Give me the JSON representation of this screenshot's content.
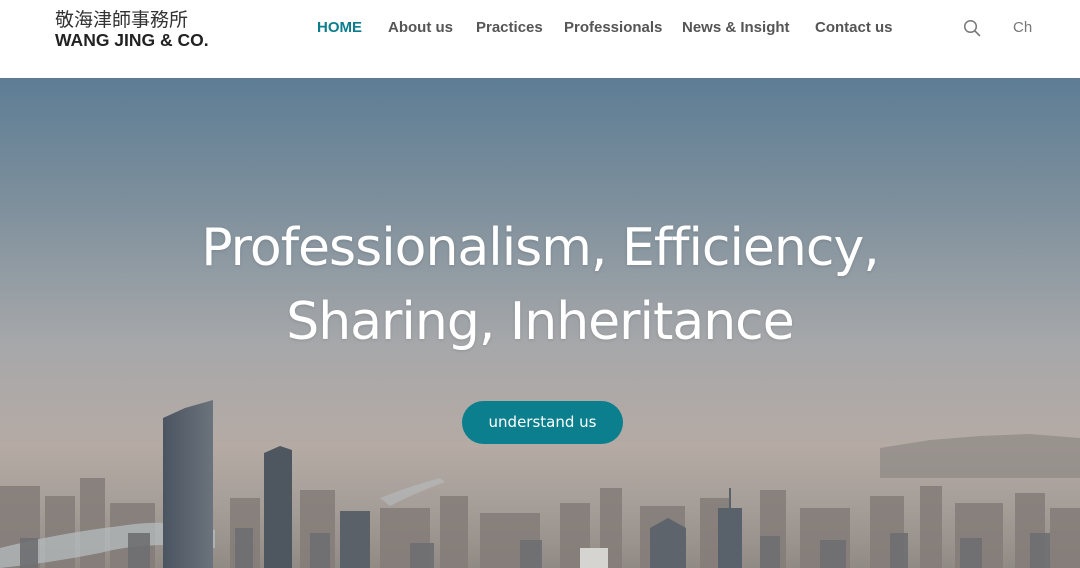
{
  "logo": {
    "chinese": "敬海津師事務所",
    "english": "WANG JING & CO."
  },
  "nav": {
    "items": [
      {
        "label": "HOME",
        "active": true
      },
      {
        "label": "About us"
      },
      {
        "label": "Practices"
      },
      {
        "label": "Professionals"
      },
      {
        "label": "News & Insight"
      },
      {
        "label": "Contact us"
      }
    ],
    "search_icon": "search-icon",
    "language": "Ch"
  },
  "hero": {
    "headline_line1": "Professionalism, Efficiency,",
    "headline_line2": "Sharing, Inheritance",
    "cta_label": "understand us",
    "background_image": "city skyline aerial view"
  },
  "colors": {
    "accent": "#0a7e8c",
    "nav_text": "#555555",
    "button": "#0b7f8e"
  }
}
